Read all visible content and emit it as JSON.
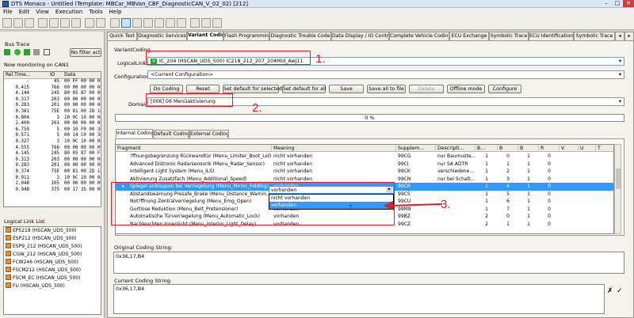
{
  "window": {
    "title": "DTS Monaco - Untitled (Template: MBCar_MBVan_CBF_DiagnosticCAN_V_02_02) [212]"
  },
  "menu": [
    "File",
    "Edit",
    "View",
    "Execution",
    "Tools",
    "Help"
  ],
  "tabs": [
    "Quick Test",
    "Diagnostic Services",
    "Variant Coding",
    "Flash Programming",
    "Diagnostic Trouble Code",
    "Data Display / IO Control",
    "Complete Vehicle Coding",
    "ECU Exchange",
    "Symbolic Trace",
    "ECU Identification",
    "Symbolic Trace"
  ],
  "left": {
    "bus_trace": "Bus Trace",
    "filter_btn": "No filter act",
    "monitoring": "Now monitoring on CAN1",
    "trace_headers": [
      "Rel.Time...",
      "ID",
      "Data"
    ],
    "trace_rows": [
      [
        "-",
        "45",
        "00 FF 00 00 00"
      ],
      [
        "0.415",
        "766",
        "00 00 00 00 00"
      ],
      [
        "4.144",
        "245",
        "80 05 87 00 00"
      ],
      [
        "0.317",
        "203",
        "00 00 00 00 00"
      ],
      [
        "0.283",
        "201",
        "00 00 00 00 00"
      ],
      [
        "0.381",
        "75E",
        "00 81 00 2D 18"
      ],
      [
        "0.804",
        "3",
        "10 0C 10 00 04"
      ],
      [
        "2.400",
        "201",
        "00 00 00 00 00"
      ],
      [
        "6.759",
        "5",
        "00 10 F0 00 3C"
      ],
      [
        "0.571",
        "5",
        "00 14 C0 00 34"
      ],
      [
        "0.327",
        "3",
        "10 0C 10 00 04"
      ],
      [
        "4.555",
        "766",
        "00 00 00 00 00"
      ],
      [
        "4.145",
        "245",
        "80 05 87 00 FF"
      ],
      [
        "0.313",
        "203",
        "00 00 00 00 00"
      ],
      [
        "0.283",
        "201",
        "00 00 00 00 00"
      ],
      [
        "0.374",
        "75E",
        "00 81 00 2D 18"
      ],
      [
        "0.911",
        "3",
        "10 0C 10 00 04"
      ],
      [
        "2.048",
        "105",
        "00 00 00 00 00"
      ],
      [
        "0.948",
        "375",
        "00 17 35 00 00"
      ]
    ],
    "logical_link_list": "Logical Link List",
    "links": [
      "EPS218 (HSCAN_UDS_500)",
      "ESP212 (HSCAN_UDS_500)",
      "ESP9_212 (HSCAN_UDS_500)",
      "CGW_212 (HSCAN_UDS_500)",
      "FCW246 (HSCAN_UDS_500)",
      "FSCM212 (HSCAN_UDS_500)",
      "FSCM_EC (HSCAN_UDS_500)",
      "FU (HSCAN_UDS_500)"
    ]
  },
  "main": {
    "section": "VariantCoding",
    "logical_link_label": "LogicalLink:",
    "logical_link_value": "IC_204 (HSCAN_UDS_500) IC218_212_207_204Mid_AwJ11",
    "configuration_label": "Configuration:",
    "configuration_value": "<Current Configuration>",
    "buttons": [
      "Do Coding",
      "Reset",
      "Set default for selected",
      "Set default for all",
      "Save",
      "Save all to file",
      "Delete",
      "Offline mode",
      "Configure"
    ],
    "domain_label": "Domain:",
    "domain_value": "[006] 06 Menüaktivierung",
    "progress": "0 %",
    "subtabs": [
      "Internal Coding",
      "Default Coding",
      "External Coding"
    ],
    "grid_headers": [
      "Fragment",
      "Meaning",
      "Supplem...",
      "Descripti...",
      "B...",
      "B",
      "B",
      "R",
      "V",
      "U",
      "T"
    ],
    "rows": [
      [
        "?ffnungsbegrenzung Rückwandtür (Menu_Limiter_Boot_Lid)",
        "nicht vorhanden",
        "99CG",
        "nur Baumuste...",
        "1",
        "0",
        "1",
        "0"
      ],
      [
        "Advanced Distronic Radarsensorik (Menu_Radar_Sensor)",
        "nicht vorhanden",
        "99CI",
        "nur SA ADTR",
        "1",
        "1",
        "1",
        "0"
      ],
      [
        "Intelligent Light System (Menu_ILS)",
        "nicht vorhanden",
        "99CK",
        "verschiedene...",
        "1",
        "2",
        "1",
        "0"
      ],
      [
        "Aktivierung Zusatzfach (Menu_Additional_Speed)",
        "nicht vorhanden",
        "99CN",
        "nur bei Schalt...",
        "1",
        "3",
        "1",
        "0"
      ],
      [
        "Spiegel anklappen bei Verriegelung (Menu_Mirror_Folding)",
        "vorhanden",
        "99CR",
        "",
        "1",
        "4",
        "1",
        "0"
      ],
      [
        "Abstandswarnung Presafe_Brake (Menu_Distance_Warnin...",
        "nicht vorhanden",
        "99CS",
        "",
        "1",
        "5",
        "1",
        "0"
      ],
      [
        "Not?ffnung Zentralverriegelung (Menu_Emg_Open)",
        "vorhanden",
        "99CU",
        "",
        "1",
        "6",
        "1",
        "0"
      ],
      [
        "Gurtlose Reduktion (Menu_Belt_Pretensioner)",
        "vorhanden",
        "99M9",
        "",
        "1",
        "7",
        "1",
        "0"
      ],
      [
        "Automatische Türverriegelung (Menu_Automatic_Lock)",
        "vorhanden",
        "99BZ",
        "",
        "2",
        "0",
        "1",
        "0"
      ],
      [
        "Nachleuchten Innenlicht (Menu_Interior_Light_Delay)",
        "vorhanden",
        "99CZ",
        "",
        "2",
        "1",
        "1",
        "0"
      ]
    ],
    "dropdown_options": [
      "nicht vorhanden",
      "vorhanden"
    ],
    "original_label": "Original Coding String:",
    "original_value": "0x36,17,B4",
    "current_label": "Current Coding String:",
    "current_value": "0x36,17,B4"
  },
  "annotations": [
    "1.",
    "2.",
    "3."
  ]
}
